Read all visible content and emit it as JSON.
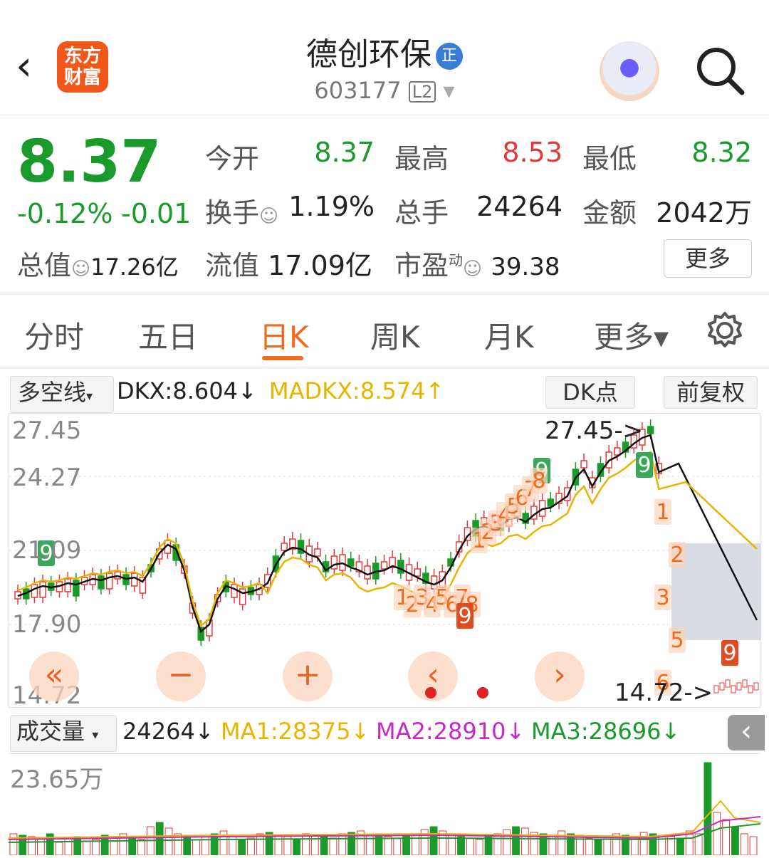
{
  "header": {
    "back_glyph": "‹",
    "logo_text": "东方财富",
    "stock_name": "德创环保",
    "badge_text": "正",
    "stock_code": "603177",
    "level_tag": "L2",
    "dropdown_glyph": "▾"
  },
  "quote": {
    "price": "8.37",
    "change_pct": "-0.12%",
    "change_abs": "-0.01",
    "open_label": "今开",
    "open_value": "8.37",
    "high_label": "最高",
    "high_value": "8.53",
    "low_label": "最低",
    "low_value": "8.32",
    "turnover_label": "换手",
    "turnover_value": "1.19%",
    "volume_label": "总手",
    "volume_value": "24264",
    "amount_label": "金额",
    "amount_value": "2042万",
    "mktcap_label": "总值",
    "mktcap_value": "17.26亿",
    "float_label": "流值",
    "float_value": "17.09亿",
    "pe_label": "市盈",
    "pe_sup": "动",
    "pe_value": "39.38",
    "more_button": "更多",
    "info_glyph": "☺"
  },
  "tabs": [
    {
      "label": "分时"
    },
    {
      "label": "五日"
    },
    {
      "label": "日K"
    },
    {
      "label": "周K"
    },
    {
      "label": "月K"
    },
    {
      "label": "更多▾"
    }
  ],
  "active_tab": "日K",
  "indicator_bar": {
    "indicator_select": "多空线",
    "dkx": "DKX:8.604↓",
    "madkx": "MADKX:8.574↑",
    "dk_button": "DK点",
    "fq_button": "前复权"
  },
  "kline": {
    "y_labels": [
      "27.45",
      "24.27",
      "21.09",
      "17.90",
      "14.72"
    ],
    "high_marker": "27.45->",
    "low_marker": "14.72->",
    "colors": {
      "up": "#e23a3a",
      "down": "#1a9a2a",
      "dkx": "#111111",
      "madkx": "#e8b400",
      "td_count": "#f26a1b"
    }
  },
  "overlay_controls": {
    "rewind": "«",
    "zoom_out": "−",
    "zoom_in": "+",
    "prev": "‹",
    "next": "›"
  },
  "volume_bar": {
    "indicator_select": "成交量",
    "vol": "24264↓",
    "ma1": "MA1:28375↓",
    "ma2": "MA2:28910↓",
    "ma3": "MA3:28696↓",
    "collapse_glyph": "‹"
  },
  "volume_chart": {
    "y_label": "23.65万",
    "colors": {
      "ma1": "#e8b400",
      "ma2": "#c828c8",
      "ma3": "#1a9a2a"
    }
  }
}
